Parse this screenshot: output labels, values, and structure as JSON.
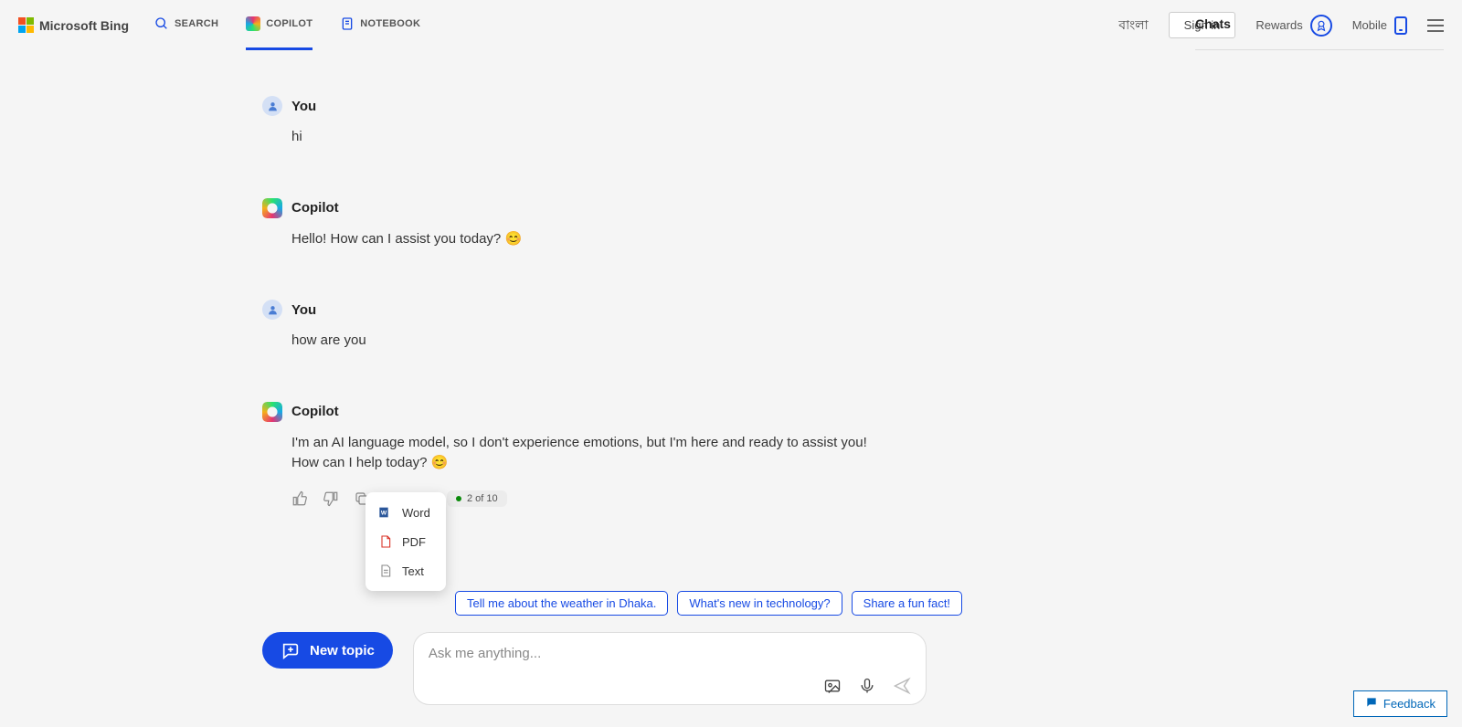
{
  "header": {
    "logo_text": "Microsoft Bing",
    "tabs": {
      "search": "SEARCH",
      "copilot": "COPILOT",
      "notebook": "NOTEBOOK"
    },
    "language": "বাংলা",
    "signin": "Sign in",
    "rewards": "Rewards",
    "mobile": "Mobile"
  },
  "panel": {
    "chats_title": "Chats"
  },
  "conversation": [
    {
      "sender": "You",
      "role": "user",
      "body": "hi"
    },
    {
      "sender": "Copilot",
      "role": "copilot",
      "body": "Hello! How can I assist you today? 😊"
    },
    {
      "sender": "You",
      "role": "user",
      "body": "how are you"
    },
    {
      "sender": "Copilot",
      "role": "copilot",
      "body": "I'm an AI language model, so I don't experience emotions, but I'm here and ready to assist you! How can I help today? 😊"
    }
  ],
  "counter": {
    "text": "2 of 10"
  },
  "export_menu": {
    "word": "Word",
    "pdf": "PDF",
    "text": "Text"
  },
  "suggestions": [
    "Tell me about the weather in Dhaka.",
    "What's new in technology?",
    "Share a fun fact!"
  ],
  "composer": {
    "new_topic": "New topic",
    "placeholder": "Ask me anything..."
  },
  "feedback": {
    "label": "Feedback"
  }
}
